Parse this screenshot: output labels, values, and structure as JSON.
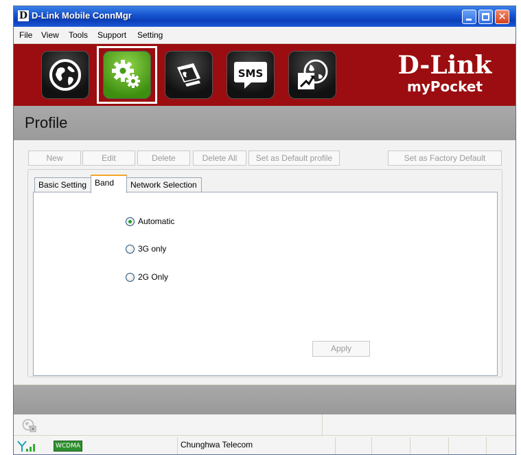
{
  "window": {
    "title": "D-Link Mobile ConnMgr",
    "app_icon": "D"
  },
  "menu": [
    "File",
    "View",
    "Tools",
    "Support",
    "Setting"
  ],
  "nav": {
    "buttons": [
      {
        "icon": "globe-icon",
        "active": false
      },
      {
        "icon": "gears-icon",
        "active": true
      },
      {
        "icon": "phonebook-icon",
        "active": false
      },
      {
        "icon": "sms-icon",
        "label": "SMS",
        "active": false
      },
      {
        "icon": "network-stats-icon",
        "active": false
      }
    ]
  },
  "brand": {
    "name": "D-Link",
    "tagline": "myPocket"
  },
  "page": {
    "title": "Profile"
  },
  "actions": {
    "new": "New",
    "edit": "Edit",
    "delete": "Delete",
    "delete_all": "Delete All",
    "set_default": "Set as Default profile",
    "factory_default": "Set as Factory Default"
  },
  "tabs": [
    "Basic Setting",
    "Band",
    "Network Selection"
  ],
  "active_tab": "Band",
  "band": {
    "options": [
      "Automatic",
      "3G only",
      "2G Only"
    ],
    "selected": "Automatic",
    "apply": "Apply"
  },
  "status": {
    "network_type": "WCDMA",
    "carrier": "Chunghwa Telecom"
  },
  "colors": {
    "banner": "#9b0d10",
    "active_nav": "#5aa81e",
    "tab_highlight": "#f5a623"
  }
}
